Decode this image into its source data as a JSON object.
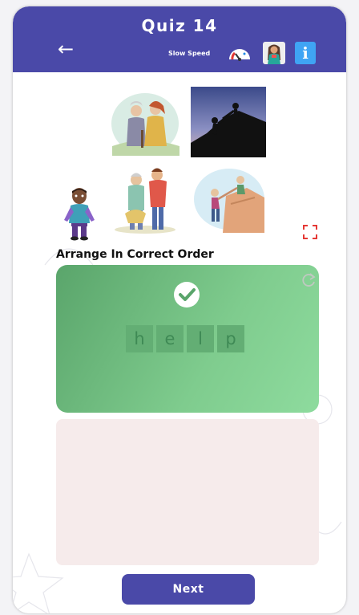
{
  "header": {
    "title": "Quiz 14",
    "speed_label": "Slow Speed",
    "info_label": "i"
  },
  "prompt": "Arrange In Correct Order",
  "answer": {
    "letters": [
      "h",
      "e",
      "l",
      "p"
    ]
  },
  "next_label": "Next",
  "colors": {
    "header": "#4a49a8",
    "answer_green": "#7fcc8e",
    "tray": "#f6ebeb",
    "info_blue": "#3fa4f4"
  },
  "icons": {
    "back": "back-arrow-icon",
    "speed": "speedometer-icon",
    "character": "character-avatar-icon",
    "info": "info-icon",
    "expand": "expand-icon",
    "refresh": "refresh-icon",
    "check": "check-icon"
  }
}
